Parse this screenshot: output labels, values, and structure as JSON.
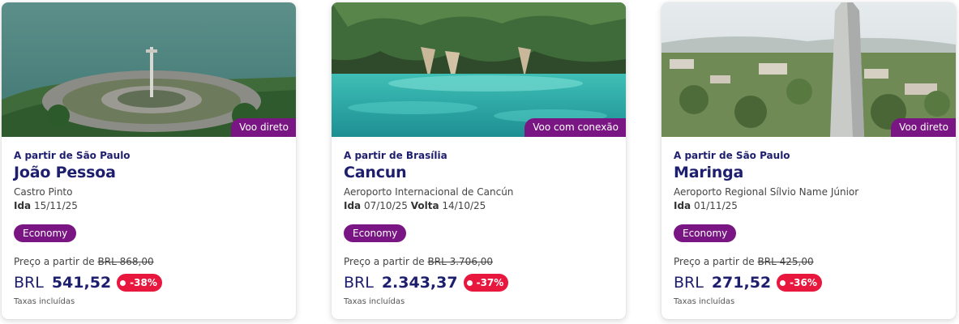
{
  "cards": [
    {
      "flight_type": "Voo direto",
      "origin": "A partir de São Paulo",
      "city": "João Pessoa",
      "airport": "Castro Pinto",
      "outbound_label": "Ida",
      "outbound_date": "15/11/25",
      "return_label": "",
      "return_date": "",
      "cabin": "Economy",
      "from_text": "Preço a partir de",
      "old_price": "BRL  868,00",
      "currency": "BRL",
      "price": "541,52",
      "discount": "-38%",
      "taxes": "Taxas incluídas",
      "image_icon": "aerial-coastal-complex-photo"
    },
    {
      "flight_type": "Voo com conexão",
      "origin": "A partir de Brasília",
      "city": "Cancun",
      "airport": "Aeroporto Internacional de Cancún",
      "outbound_label": "Ida",
      "outbound_date": "07/10/25",
      "return_label": "Volta",
      "return_date": "14/10/25",
      "cabin": "Economy",
      "from_text": "Preço a partir de",
      "old_price": "BRL  3.706,00",
      "currency": "BRL",
      "price": "2.343,37",
      "discount": "-37%",
      "taxes": "Taxas incluídas",
      "image_icon": "cenote-cave-photo"
    },
    {
      "flight_type": "Voo direto",
      "origin": "A partir de São Paulo",
      "city": "Maringa",
      "airport": "Aeroporto Regional Sílvio Name Júnior",
      "outbound_label": "Ida",
      "outbound_date": "01/11/25",
      "return_label": "",
      "return_date": "",
      "cabin": "Economy",
      "from_text": "Preço a partir de",
      "old_price": "BRL  425,00",
      "currency": "BRL",
      "price": "271,52",
      "discount": "-36%",
      "taxes": "Taxas incluídas",
      "image_icon": "city-cathedral-photo"
    }
  ],
  "colors": {
    "brand_purple": "#7a1683",
    "navy": "#1e1e6e",
    "discount_red": "#e8173e"
  }
}
